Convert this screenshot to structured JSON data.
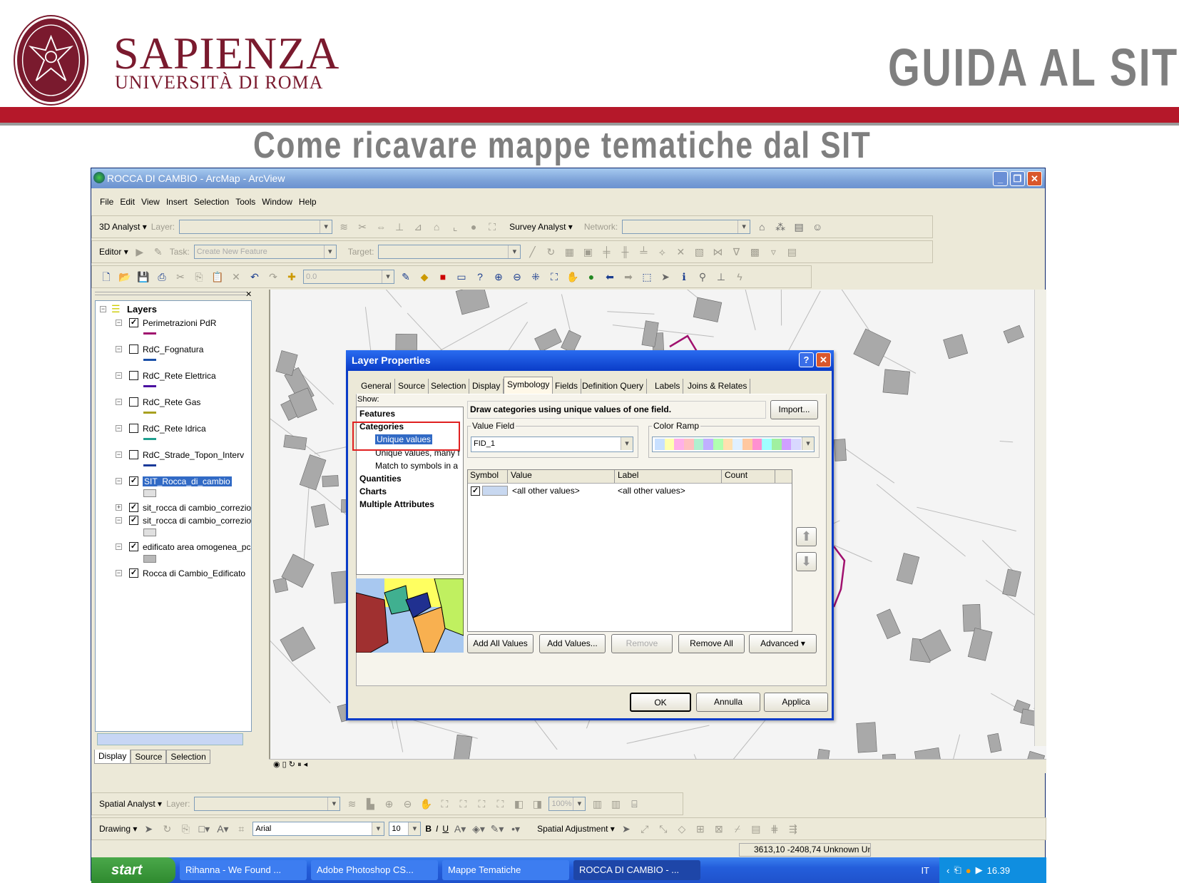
{
  "slide": {
    "brand_name": "SAPIENZA",
    "brand_sub": "UNIVERSITÀ DI ROMA",
    "logo_text": "STVDIVM VRBIS",
    "heading": "GUIDA AL SIT",
    "subtitle": "Come ricavare mappe tematiche dal SIT",
    "band_color": "#b5182a"
  },
  "window": {
    "title": "ROCCA DI CAMBIO - ArcMap - ArcView"
  },
  "menu": [
    "File",
    "Edit",
    "View",
    "Insert",
    "Selection",
    "Tools",
    "Window",
    "Help"
  ],
  "toolbars": {
    "analyst3d": {
      "label": "3D Analyst",
      "layer_label": "Layer:",
      "survey": "Survey Analyst",
      "network_label": "Network:"
    },
    "editor": {
      "label": "Editor",
      "task_label": "Task:",
      "task_value": "Create New Feature",
      "target_label": "Target:"
    },
    "standard": {
      "scale_value": "0.0"
    },
    "spatial": {
      "label": "Spatial Analyst",
      "layer_label": "Layer:",
      "zoom_value": "100%"
    },
    "drawing": {
      "label": "Drawing",
      "font": "Arial",
      "size": "10",
      "bold": "B",
      "italic": "I",
      "underline": "U",
      "spatial_adjustment": "Spatial Adjustment"
    }
  },
  "toc": {
    "root": "Layers",
    "layers": [
      {
        "name": "Perimetrazioni PdR",
        "checked": true,
        "color": "#a0106e"
      },
      {
        "name": "RdC_Fognatura",
        "checked": false,
        "color": "#1a4fa8"
      },
      {
        "name": "RdC_Rete Elettrica",
        "checked": false,
        "color": "#4a0fa0"
      },
      {
        "name": "RdC_Rete Gas",
        "checked": false,
        "color": "#a8a020"
      },
      {
        "name": "RdC_Rete Idrica",
        "checked": false,
        "color": "#20a090"
      },
      {
        "name": "RdC_Strade_Topon_Interv",
        "checked": false,
        "color": "#1a3a9a"
      },
      {
        "name": "SIT_Rocca_di_cambio",
        "checked": true,
        "selected": true
      },
      {
        "name": "sit_rocca di cambio_correzio",
        "checked": true
      },
      {
        "name": "sit_rocca di cambio_correzio",
        "checked": true
      },
      {
        "name": "edificato area omogenea_pc",
        "checked": true
      },
      {
        "name": "Rocca di Cambio_Edificato",
        "checked": true
      }
    ],
    "tabs": [
      "Display",
      "Source",
      "Selection"
    ]
  },
  "dialog": {
    "title": "Layer Properties",
    "tabs": [
      "General",
      "Source",
      "Selection",
      "Display",
      "Symbology",
      "Fields",
      "Definition Query",
      "Labels",
      "Joins & Relates"
    ],
    "active_tab": "Symbology",
    "show_label": "Show:",
    "show_items": [
      "Features",
      "Categories",
      "Unique values",
      "Unique values, many f",
      "Match to symbols in a",
      "Quantities",
      "Charts",
      "Multiple Attributes"
    ],
    "selected_item": "Unique values",
    "description": "Draw categories using unique values of one field.",
    "import": "Import...",
    "value_field_label": "Value Field",
    "value_field": "FID_1",
    "color_ramp_label": "Color Ramp",
    "color_ramp": [
      "#c8e0ff",
      "#ffffb0",
      "#ffb0e8",
      "#ffc0c0",
      "#b0f0d0",
      "#c0b0ff",
      "#b0ffb0",
      "#ffe0b0",
      "#e0f0ff",
      "#ffc8a0",
      "#ff90d0",
      "#a0ffff",
      "#a0f0a0",
      "#d0a0ff",
      "#d8d8ff"
    ],
    "columns": [
      "Symbol",
      "Value",
      "Label",
      "Count"
    ],
    "rows": [
      {
        "value": "<all other values>",
        "label": "<all other values>",
        "count": "",
        "color": "#c8d8f0"
      }
    ],
    "buttons": {
      "add_all": "Add All Values",
      "add_values": "Add Values...",
      "remove": "Remove",
      "remove_all": "Remove All",
      "advanced": "Advanced",
      "ok": "OK",
      "cancel": "Annulla",
      "apply": "Applica"
    }
  },
  "status": {
    "coords": "3613,10  -2408,74 Unknown Uni"
  },
  "taskbar": {
    "start": "start",
    "tasks": [
      "Rihanna - We Found ...",
      "Adobe Photoshop CS...",
      "Mappe Tematiche",
      "ROCCA DI CAMBIO - ..."
    ],
    "lang": "IT",
    "time": "16.39"
  }
}
